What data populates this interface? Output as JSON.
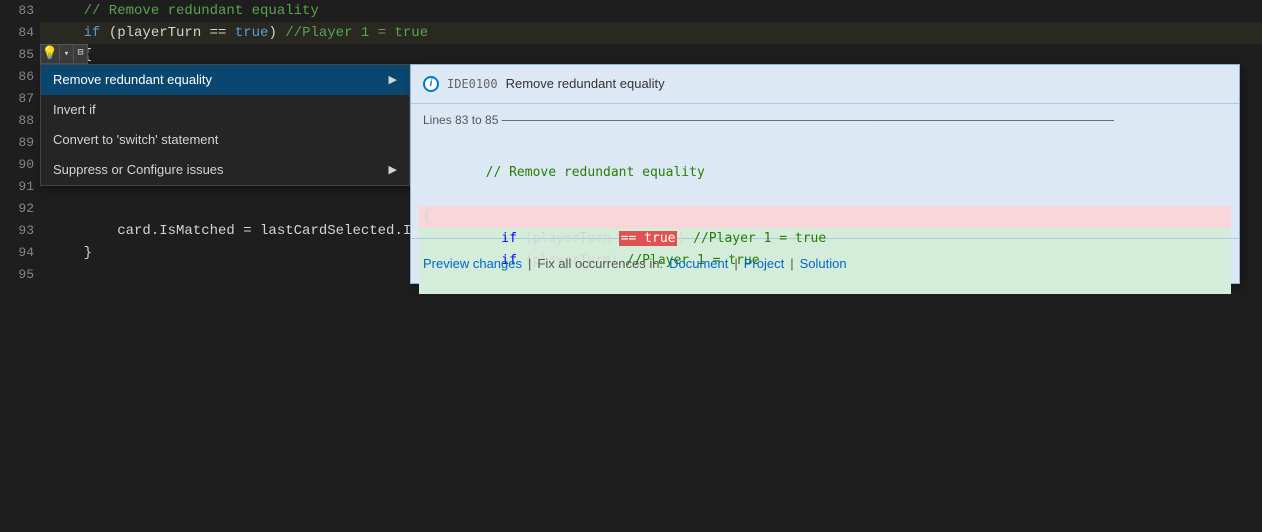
{
  "editor": {
    "background": "#1e1e1e",
    "lines": [
      {
        "num": 83,
        "content": "    // Remove redundant equality",
        "type": "comment"
      },
      {
        "num": 84,
        "content": "    if (playerTurn == true) //Player 1 = true",
        "type": "code-highlight"
      },
      {
        "num": 85,
        "content": "    {",
        "type": "code"
      },
      {
        "num": 86,
        "content": "",
        "type": "code"
      },
      {
        "num": 87,
        "content": "",
        "type": "code"
      },
      {
        "num": 88,
        "content": "",
        "type": "code"
      },
      {
        "num": 89,
        "content": "",
        "type": "code"
      },
      {
        "num": 90,
        "content": "",
        "type": "code"
      },
      {
        "num": 91,
        "content": "",
        "type": "code"
      },
      {
        "num": 92,
        "content": "",
        "type": "code"
      },
      {
        "num": 93,
        "content": "        card.IsMatched = lastCardSelected.IsMatched =",
        "type": "code"
      },
      {
        "num": 94,
        "content": "    }",
        "type": "code"
      },
      {
        "num": 95,
        "content": "",
        "type": "code"
      }
    ]
  },
  "lightbulb": {
    "icon": "💡",
    "arrow": "▾",
    "small": "⊟"
  },
  "context_menu": {
    "items": [
      {
        "label": "Remove redundant equality",
        "arrow": "▶",
        "selected": true
      },
      {
        "label": "Invert if",
        "arrow": null
      },
      {
        "label": "Convert to 'switch' statement",
        "arrow": null
      },
      {
        "label": "Suppress or Configure issues",
        "arrow": "▶"
      }
    ]
  },
  "preview_panel": {
    "header": {
      "code": "IDE0100",
      "text": "Remove redundant equality"
    },
    "lines_label": "Lines 83 to 85",
    "code_lines": [
      {
        "type": "comment",
        "text": "// Remove redundant equality"
      },
      {
        "type": "removed",
        "text": "if (playerTurn == true) //Player 1 = true",
        "highlight": "== true"
      },
      {
        "type": "added",
        "text": "if (playerTurn) //Player 1 = true"
      },
      {
        "type": "normal",
        "text": "{"
      }
    ],
    "footer": {
      "preview_label": "Preview changes",
      "fix_all_label": "Fix all occurrences in:",
      "fix_links": [
        "Document",
        "Project",
        "Solution"
      ]
    }
  }
}
